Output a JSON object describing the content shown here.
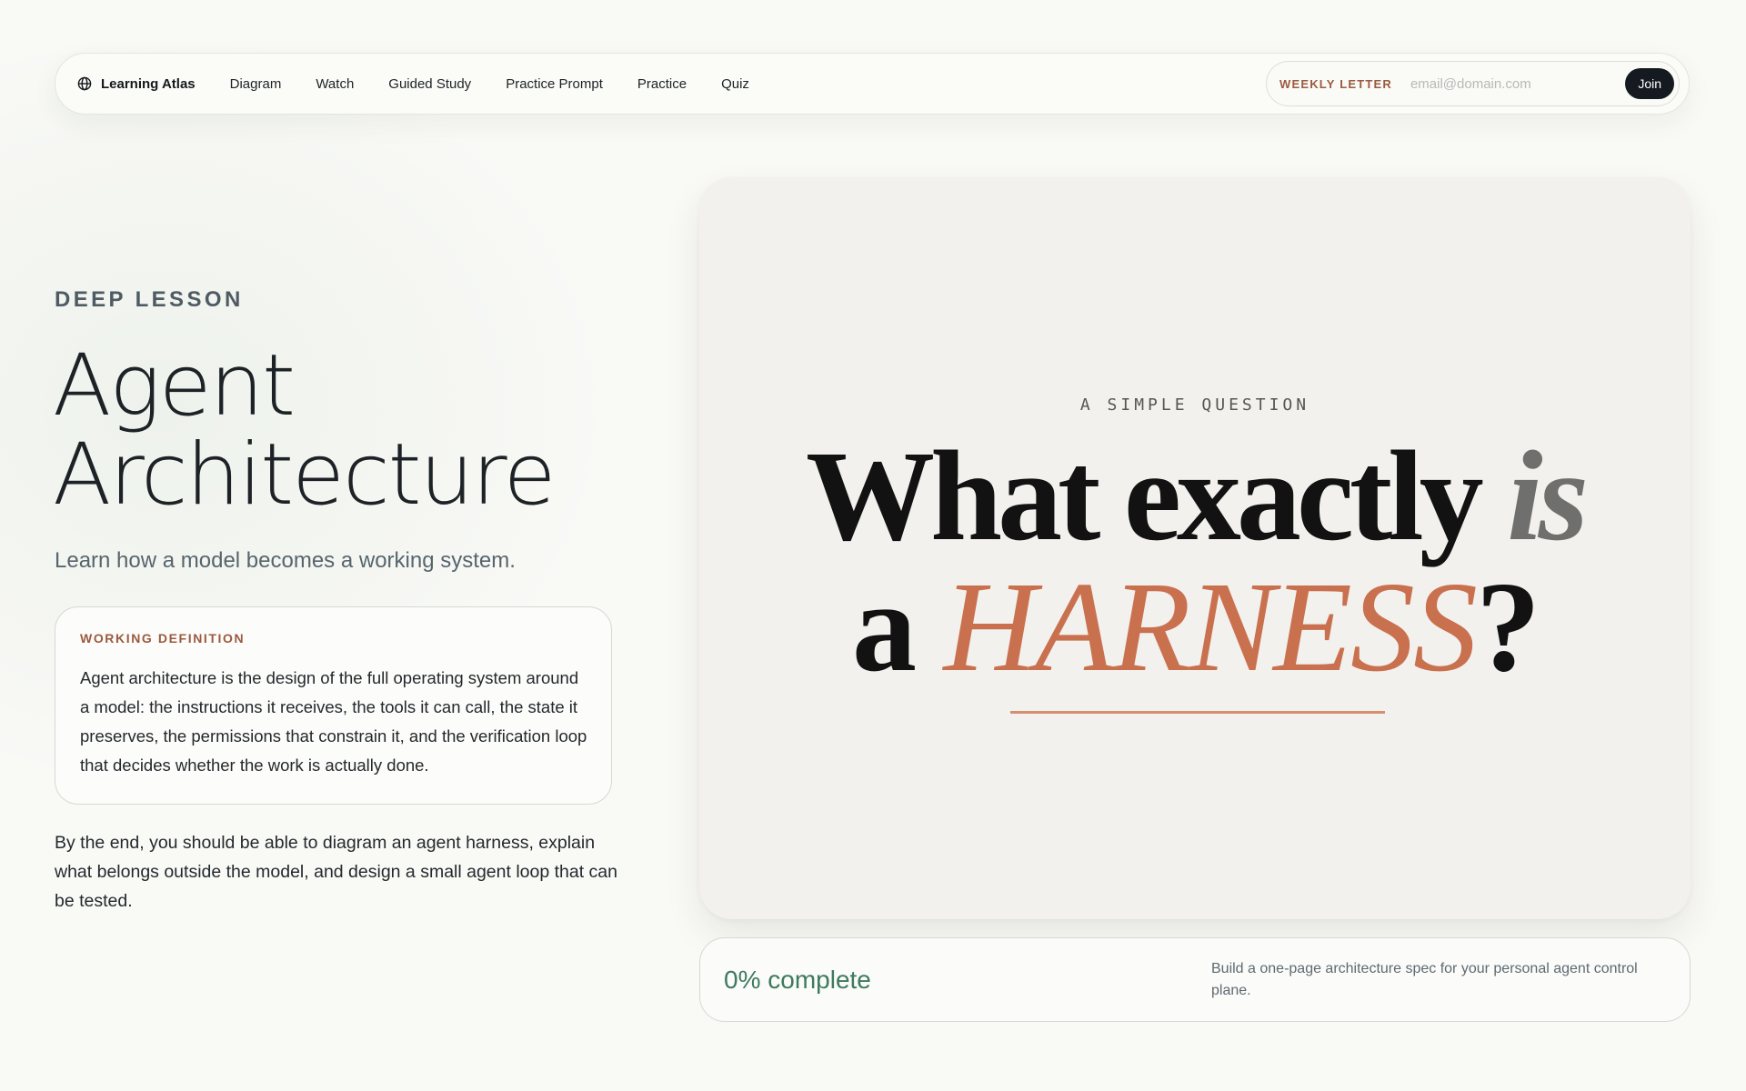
{
  "nav": {
    "brand": "Learning Atlas",
    "brand_icon": "globe-icon",
    "links": [
      "Diagram",
      "Watch",
      "Guided Study",
      "Practice Prompt",
      "Practice",
      "Quiz"
    ],
    "newsletter_label": "WEEKLY LETTER",
    "newsletter_placeholder": "email@domain.com",
    "join_label": "Join"
  },
  "lesson": {
    "eyebrow": "DEEP LESSON",
    "title_line1": "Agent",
    "title_line2": "Architecture",
    "lead": "Learn how a model becomes a working system.",
    "definition_label": "WORKING DEFINITION",
    "definition_body": "Agent architecture is the design of the full operating system around a model: the instructions it receives, the tools it can call, the state it preserves, the permissions that constrain it, and the verification loop that decides whether the work is actually done.",
    "outro": "By the end, you should be able to diagram an agent harness, explain what belongs outside the model, and design a small agent loop that can be tested."
  },
  "video": {
    "kicker": "A SIMPLE QUESTION",
    "line1_main": "What exactly ",
    "line1_emph": "is",
    "line2_pre": "a ",
    "line2_emph": "HARNESS",
    "line2_post": "?"
  },
  "progress": {
    "percent": 0,
    "label": "0% complete",
    "note": "Build a one-page architecture spec for your personal agent control plane."
  },
  "colors": {
    "accent_rust": "#9b5a40",
    "harness_orange": "#c9714f",
    "progress_green": "#3d7a5e",
    "button_dark": "#141a20"
  }
}
